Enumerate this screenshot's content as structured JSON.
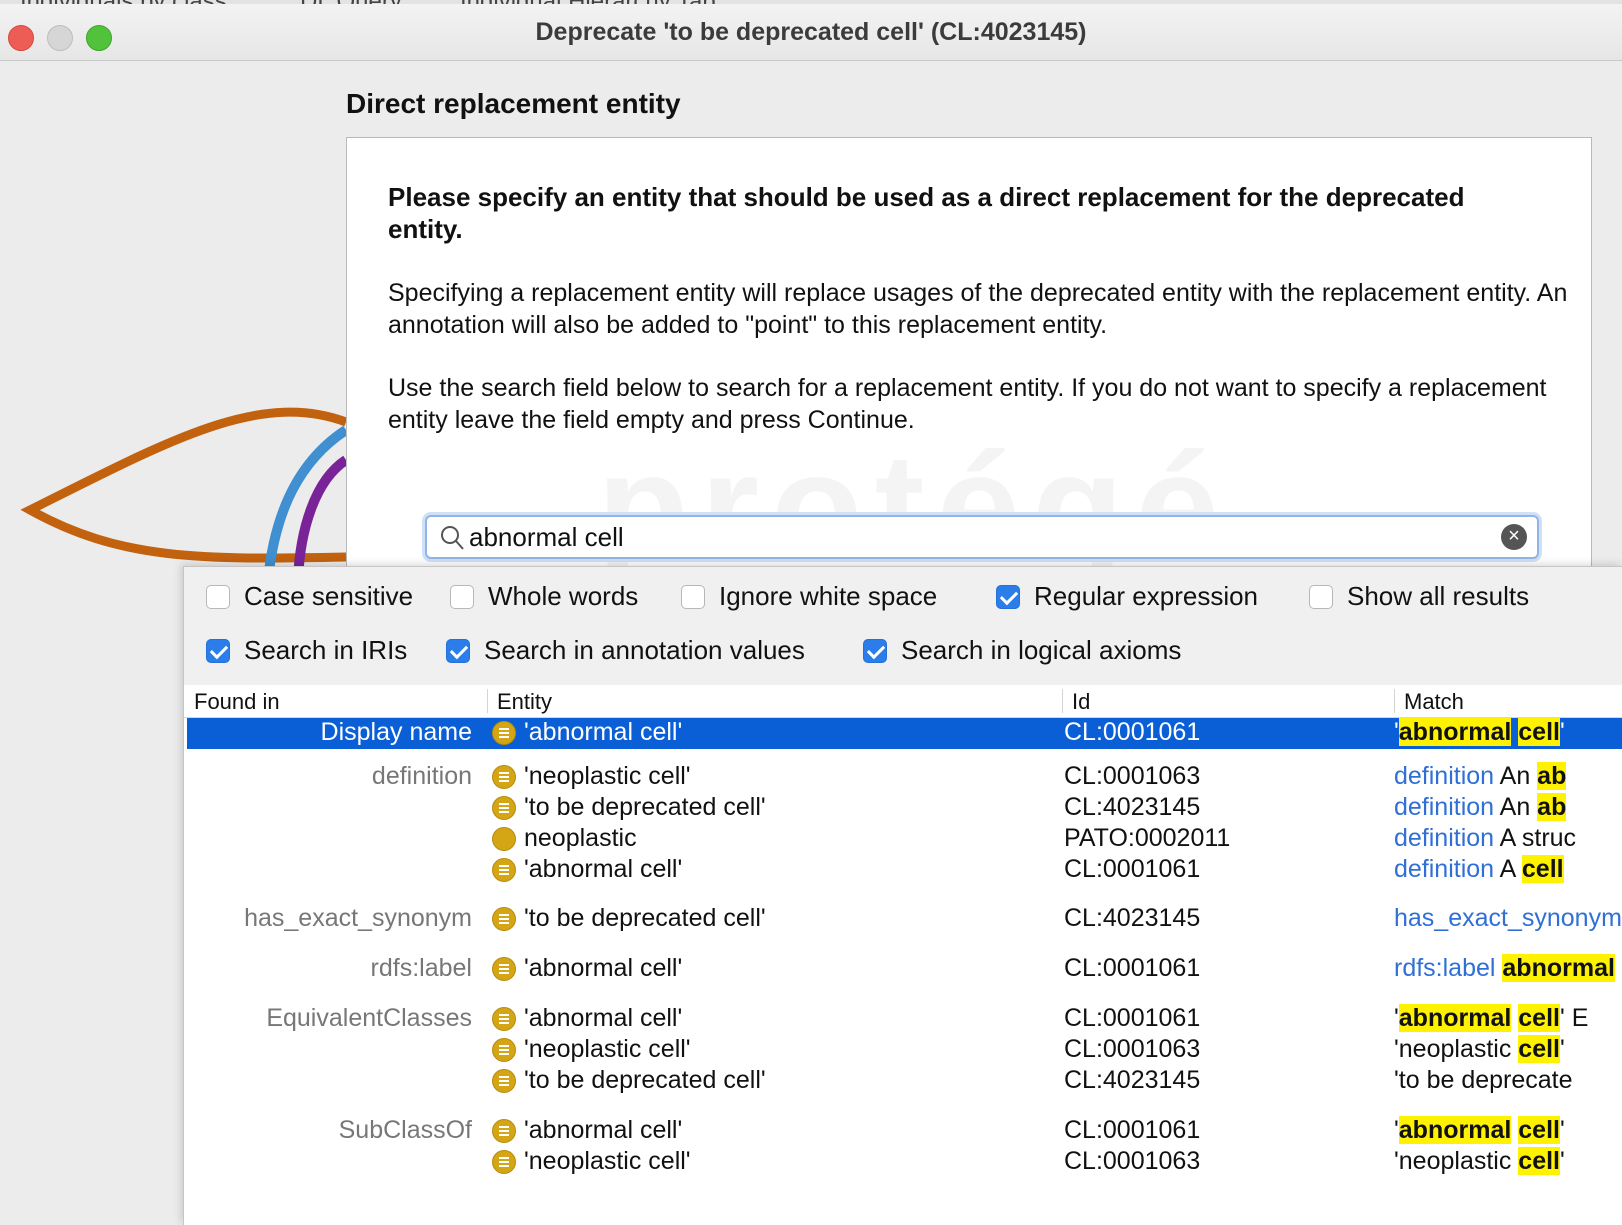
{
  "window": {
    "title": "Deprecate 'to be deprecated cell' (CL:4023145)",
    "background_tabs": [
      "Individuals by class",
      "DL Query",
      "Individual Hierarchy Tab"
    ]
  },
  "section_title": "Direct replacement entity",
  "instructions": {
    "heading": "Please specify an entity that should be used as a direct replacement for the deprecated entity.",
    "paragraph1": "Specifying a replacement entity will replace usages of the deprecated entity with the replacement entity. An annotation will also be added to \"point\" to this replacement entity.",
    "paragraph2": "Use the search field below to search for a replacement entity. If you do not want to specify a replacement entity leave the field empty and press Continue."
  },
  "search": {
    "value": "abnormal cell"
  },
  "options": [
    {
      "label": "Case sensitive",
      "checked": false
    },
    {
      "label": "Whole words",
      "checked": false
    },
    {
      "label": "Ignore white space",
      "checked": false
    },
    {
      "label": "Regular expression",
      "checked": true
    },
    {
      "label": "Show all results",
      "checked": false
    },
    {
      "label": "Search in IRIs",
      "checked": true
    },
    {
      "label": "Search in annotation values",
      "checked": true
    },
    {
      "label": "Search in logical axioms",
      "checked": true
    }
  ],
  "table": {
    "columns": [
      "Found in",
      "Entity",
      "Id",
      "Match"
    ],
    "rows": [
      {
        "found_in": "Display name",
        "entity": "'abnormal cell'",
        "id": "CL:0001061",
        "m_pre": "'",
        "m_blue": "",
        "m_h1": "abnormal",
        "m_mid": " ",
        "m_h2": "cell",
        "m_post": "'",
        "selected": true
      },
      {
        "found_in": "definition",
        "entity": "'neoplastic cell'",
        "id": "CL:0001063",
        "m_pre": "",
        "m_blue": "definition",
        "m_h1": "",
        "m_mid": " An ",
        "m_h2": "ab",
        "m_post": ""
      },
      {
        "found_in": "",
        "entity": "'to be deprecated cell'",
        "id": "CL:4023145",
        "m_pre": "",
        "m_blue": "definition",
        "m_h1": "",
        "m_mid": " An ",
        "m_h2": "ab",
        "m_post": ""
      },
      {
        "found_in": "",
        "entity": "neoplastic",
        "id": "PATO:0002011",
        "m_pre": "",
        "m_blue": "definition",
        "m_h1": "",
        "m_mid": " A struc",
        "m_h2": "",
        "m_post": ""
      },
      {
        "found_in": "",
        "entity": "'abnormal cell'",
        "id": "CL:0001061",
        "m_pre": "",
        "m_blue": "definition",
        "m_h1": "",
        "m_mid": " A ",
        "m_h2": "cell",
        "m_post": ""
      },
      {
        "found_in": "has_exact_synonym",
        "entity": "'to be deprecated cell'",
        "id": "CL:4023145",
        "m_pre": "",
        "m_blue": "has_exact_synonym",
        "m_h1": "",
        "m_mid": "",
        "m_h2": "",
        "m_post": ""
      },
      {
        "found_in": "rdfs:label",
        "entity": "'abnormal cell'",
        "id": "CL:0001061",
        "m_pre": "",
        "m_blue": "rdfs:label",
        "m_h1": "",
        "m_mid": " ",
        "m_h2": "abnormal",
        "m_post": ""
      },
      {
        "found_in": "EquivalentClasses",
        "entity": "'abnormal cell'",
        "id": "CL:0001061",
        "m_pre": "'",
        "m_blue": "",
        "m_h1": "abnormal",
        "m_mid": " ",
        "m_h2": "cell",
        "m_post": "' E"
      },
      {
        "found_in": "",
        "entity": "'neoplastic cell'",
        "id": "CL:0001063",
        "m_pre": "'neoplastic ",
        "m_blue": "",
        "m_h1": "",
        "m_mid": "",
        "m_h2": "cell",
        "m_post": "'"
      },
      {
        "found_in": "",
        "entity": "'to be deprecated cell'",
        "id": "CL:4023145",
        "m_pre": "'to be deprecate",
        "m_blue": "",
        "m_h1": "",
        "m_mid": "",
        "m_h2": "",
        "m_post": ""
      },
      {
        "found_in": "SubClassOf",
        "entity": "'abnormal cell'",
        "id": "CL:0001061",
        "m_pre": "'",
        "m_blue": "",
        "m_h1": "abnormal",
        "m_mid": " ",
        "m_h2": "cell",
        "m_post": "'"
      },
      {
        "found_in": "",
        "entity": "'neoplastic cell'",
        "id": "CL:0001063",
        "m_pre": "'neoplastic ",
        "m_blue": "",
        "m_h1": "",
        "m_mid": "",
        "m_h2": "cell",
        "m_post": "'"
      }
    ]
  },
  "colors": {
    "selection": "#0a5fd6",
    "highlight": "#fff200",
    "class_icon": "#d4a514",
    "match_link": "#2f6fd6"
  }
}
